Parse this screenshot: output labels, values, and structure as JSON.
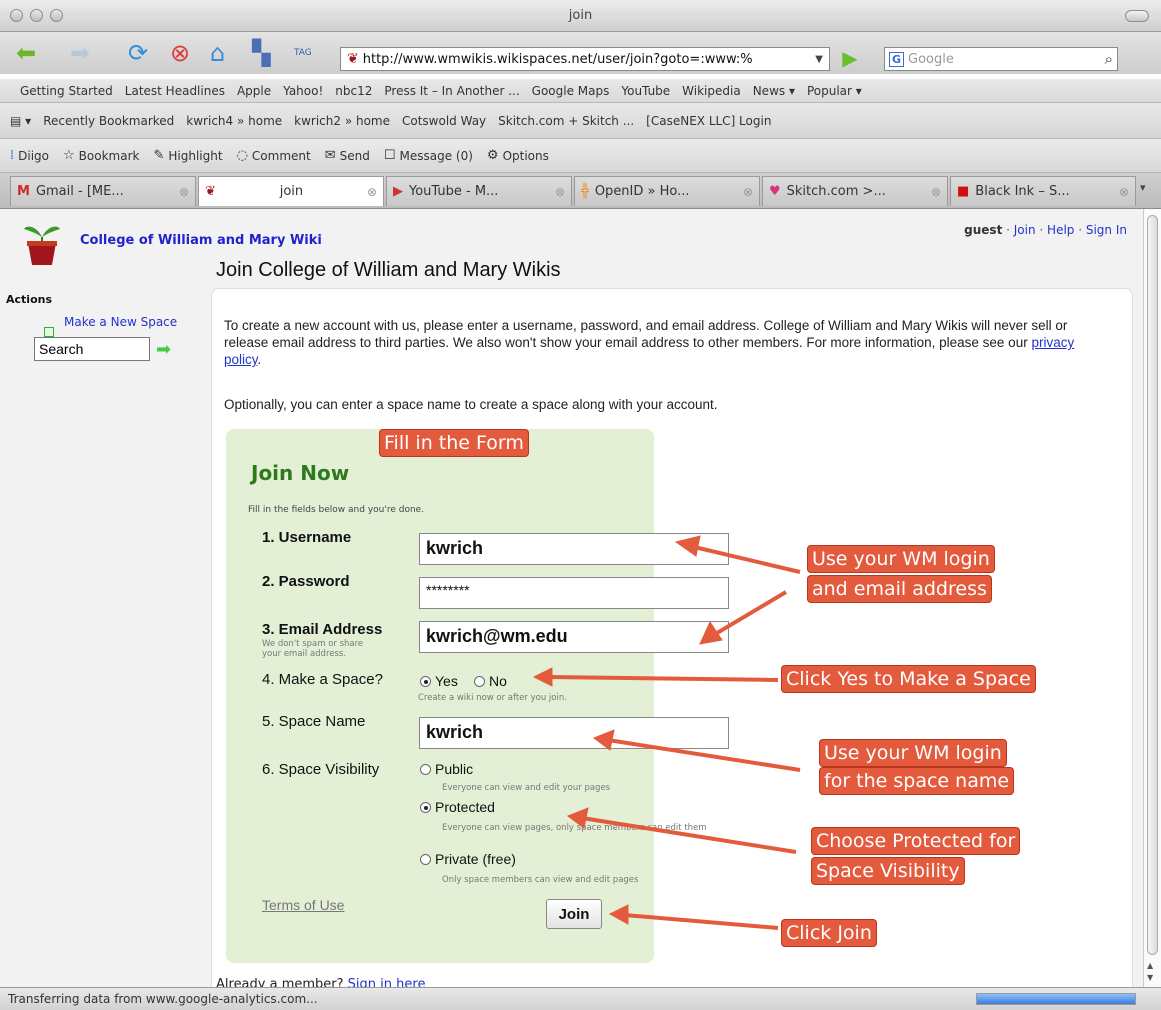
{
  "window": {
    "title": "join"
  },
  "navbar": {
    "url": "http://www.wmwikis.wikispaces.net/user/join?goto=:www:%",
    "search_placeholder": "Google",
    "search_engine": "G"
  },
  "bookmarks1": [
    "Getting Started",
    "Latest Headlines",
    "Apple",
    "Yahoo!",
    "nbc12",
    "Press It – In Another ...",
    "Google Maps",
    "YouTube",
    "Wikipedia",
    "News ▾",
    "Popular ▾"
  ],
  "bookmarks2": [
    "Recently Bookmarked",
    "kwrich4 » home",
    "kwrich2 » home",
    "Cotswold Way",
    "Skitch.com + Skitch ...",
    "[CaseNEX LLC] Login"
  ],
  "diigo": {
    "logo": "Diigo",
    "bookmark": "Bookmark",
    "highlight": "Highlight",
    "comment": "Comment",
    "send": "Send",
    "message": "Message (0)",
    "options": "Options"
  },
  "tabs": [
    "Gmail - [ME...",
    "join",
    "YouTube - M...",
    "OpenID » Ho...",
    "Skitch.com >...",
    "Black Ink – S..."
  ],
  "site": {
    "name": "College of William and Mary Wiki",
    "page_title": "Join College of William and Mary Wikis",
    "user": "guest",
    "user_links": [
      "Join",
      "Help",
      "Sign In"
    ]
  },
  "sidebar": {
    "actions_label": "Actions",
    "make_space": "Make a New Space",
    "search_value": "Search"
  },
  "intro": {
    "text": "To create a new account with us, please enter a username, password, and email address. College of William and Mary Wikis will never sell or release email address to third parties. We also won't show your email address to other members. For more information, please see our ",
    "link": "privacy policy",
    "end": ".",
    "optional": "Optionally, you can enter a space name to create a space along with your account."
  },
  "form": {
    "heading": "Join Now",
    "fill_note": "Fill in the fields below and you're done.",
    "username_label": "1. Username",
    "username_value": "kwrich",
    "password_label": "2. Password",
    "password_value": "********",
    "email_label": "3. Email Address",
    "email_sub": "We don't spam or share your email address.",
    "email_value": "kwrich@wm.edu",
    "space_q_label": "4. Make a Space?",
    "yes": "Yes",
    "no": "No",
    "space_q_sub": "Create a wiki now or after you join.",
    "space_name_label": "5. Space Name",
    "space_name_value": "kwrich",
    "visibility_label": "6. Space Visibility",
    "public": "Public",
    "public_sub": "Everyone can view and edit your pages",
    "protected": "Protected",
    "protected_sub": "Everyone can view pages, only space members can edit them",
    "private": "Private (free)",
    "private_sub": "Only space members can view and edit pages",
    "terms": "Terms of Use",
    "join_button": "Join"
  },
  "already": {
    "text": "Already a member? ",
    "link": "Sign in here"
  },
  "annotations": {
    "fill_form": "Fill in the Form",
    "login_email_1": "Use your WM login",
    "login_email_2": "and email address",
    "click_yes": "Click Yes to Make a Space",
    "space_name_1": "Use your WM login",
    "space_name_2": "for the space name",
    "protected_1": "Choose Protected for",
    "protected_2": "Space Visibility",
    "click_join": "Click Join",
    "color": "#e45a3d"
  },
  "status": {
    "text": "Transferring data from www.google-analytics.com...",
    "progress": 1.0
  }
}
